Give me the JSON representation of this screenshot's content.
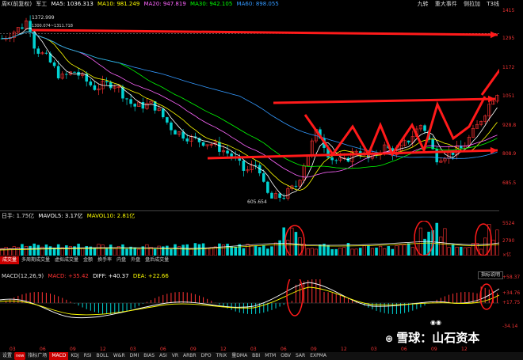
{
  "price_legend": {
    "title": "周K(前复权)",
    "code": "军工",
    "ma5": "MA5: 1036.313",
    "ma10": "MA10: 981.249",
    "ma20": "MA20: 947.819",
    "ma30": "MA30: 942.105",
    "ma60": "MA60: 898.055"
  },
  "top_right": {
    "a": "九转",
    "b": "重大事件",
    "c": "侧拉加",
    "d": "T3线"
  },
  "price_axis": [
    "1415",
    "1295",
    "1172",
    "1051",
    "928.8",
    "808.9",
    "685.5"
  ],
  "price_annotations": {
    "high": "1372.999",
    "low": "605.654",
    "range": "1300.074~1311.718"
  },
  "vol_legend": {
    "title": "日手: 1.75亿",
    "mavol5": "MAVOL5: 3.17亿",
    "mavol10": "MAVOL10: 2.81亿"
  },
  "vol_axis": [
    "5524",
    "2790",
    "×亿"
  ],
  "indicator_tabs": [
    "成交量",
    "多周期成交量",
    "虚拟成交量",
    "金额",
    "换手率",
    "内盘",
    "外盘",
    "盘后成交量"
  ],
  "macd_legend": {
    "title": "MACD(12,26,9)",
    "macd": "MACD: +35.42",
    "diff": "DIFF: +40.37",
    "dea": "DEA: +22.66"
  },
  "macd_axis": [
    "+58.37",
    "+34.76",
    "+17.75",
    "-34.14"
  ],
  "help_label": "指标说明",
  "x_axis": [
    "03",
    "06",
    "09",
    "12",
    "03",
    "06",
    "09",
    "12",
    "03",
    "06",
    "09",
    "12",
    "03",
    "06",
    "09",
    "12"
  ],
  "bottom_tabs": [
    "设置",
    "new",
    "指标广场",
    "MACD",
    "KDJ",
    "RSI",
    "BOLL",
    "W&R",
    "DMI",
    "BIAS",
    "ASI",
    "VR",
    "ARBR",
    "DPO",
    "TRIX",
    "量DMA",
    "BBI",
    "MTM",
    "OBV",
    "SAR",
    "EXPMA"
  ],
  "watermark": {
    "brand": "雪球",
    "sep": "：",
    "name": "山石资本"
  },
  "colors": {
    "up": "#ff3232",
    "down": "#00d2d2",
    "ma5": "#ffffff",
    "ma10": "#ffff00",
    "ma20": "#ff66ff",
    "ma30": "#00ff00",
    "ma60": "#3399ff",
    "arrow": "#ff1a1a"
  }
}
